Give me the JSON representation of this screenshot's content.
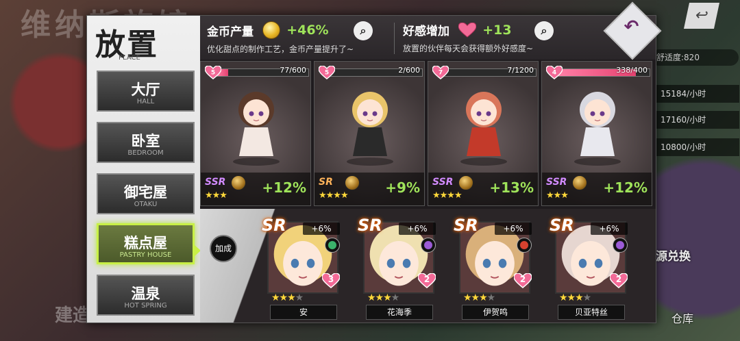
{
  "background": {
    "title": "维纳斯旅馆",
    "build_label": "建造",
    "back_icon": "return-arrow",
    "comfort": "舒适度:820",
    "rates": [
      "15184/小时",
      "17160/小时",
      "10800/小时"
    ],
    "exchange_label": "资源兑换",
    "warehouse_label": "仓库"
  },
  "sidebar": {
    "title": "放置",
    "title_en": "PLACE",
    "tabs": [
      {
        "label": "大厅",
        "en": "HALL",
        "active": false
      },
      {
        "label": "卧室",
        "en": "BEDROOM",
        "active": false
      },
      {
        "label": "御宅屋",
        "en": "OTAKU",
        "active": false
      },
      {
        "label": "糕点屋",
        "en": "PASTRY HOUSE",
        "active": true
      },
      {
        "label": "温泉",
        "en": "HOT SPRING",
        "active": false
      }
    ]
  },
  "header": {
    "gold": {
      "label": "金币产量",
      "value": "+46%",
      "desc": "优化甜点的制作工艺，金币产量提升了~",
      "icon": "gold-coin"
    },
    "affection": {
      "label": "好感增加",
      "value": "+13",
      "desc": "放置的伙伴每天会获得额外好感度~",
      "icon": "heart"
    },
    "return_icon": "return-arrow"
  },
  "characters": [
    {
      "level": "5",
      "progress": "77/600",
      "fill": 0.13,
      "rarity": "SSR",
      "stars": 3,
      "bonus": "+12%",
      "hair": "#5b3a2a",
      "outfit": "#f3e8e2"
    },
    {
      "level": "5",
      "progress": "2/600",
      "fill": 0.01,
      "rarity": "SR",
      "stars": 4,
      "bonus": "+9%",
      "hair": "#e9c46a",
      "outfit": "#2a2a2a"
    },
    {
      "level": "7",
      "progress": "7/1200",
      "fill": 0.01,
      "rarity": "SSR",
      "stars": 4,
      "bonus": "+13%",
      "hair": "#d9765a",
      "outfit": "#c33a2a"
    },
    {
      "level": "4",
      "progress": "338/400",
      "fill": 0.85,
      "rarity": "SSR",
      "stars": 3,
      "bonus": "+12%",
      "hair": "#d8d8e0",
      "outfit": "#e8e8ee"
    }
  ],
  "support": {
    "boost_label": "加成",
    "members": [
      {
        "rarity": "SR",
        "pct": "+6%",
        "heart": "3",
        "stars": 3,
        "max_stars": 4,
        "name": "安",
        "hair": "#f1d27a",
        "elem": "#3bb36b"
      },
      {
        "rarity": "SR",
        "pct": "+6%",
        "heart": "2",
        "stars": 3,
        "max_stars": 4,
        "name": "花海季",
        "hair": "#efe0b0",
        "elem": "#9b5bd6"
      },
      {
        "rarity": "SR",
        "pct": "+6%",
        "heart": "2",
        "stars": 3,
        "max_stars": 4,
        "name": "伊贺鸣",
        "hair": "#d9b07a",
        "elem": "#d6412f"
      },
      {
        "rarity": "SR",
        "pct": "+6%",
        "heart": "2",
        "stars": 3,
        "max_stars": 4,
        "name": "贝亚特丝",
        "hair": "#e6d6d0",
        "elem": "#9b5bd6"
      }
    ]
  },
  "colors": {
    "accent_green": "#9fe35a",
    "active_tab": "#c8f046",
    "heart_pink": "#e4416f"
  }
}
